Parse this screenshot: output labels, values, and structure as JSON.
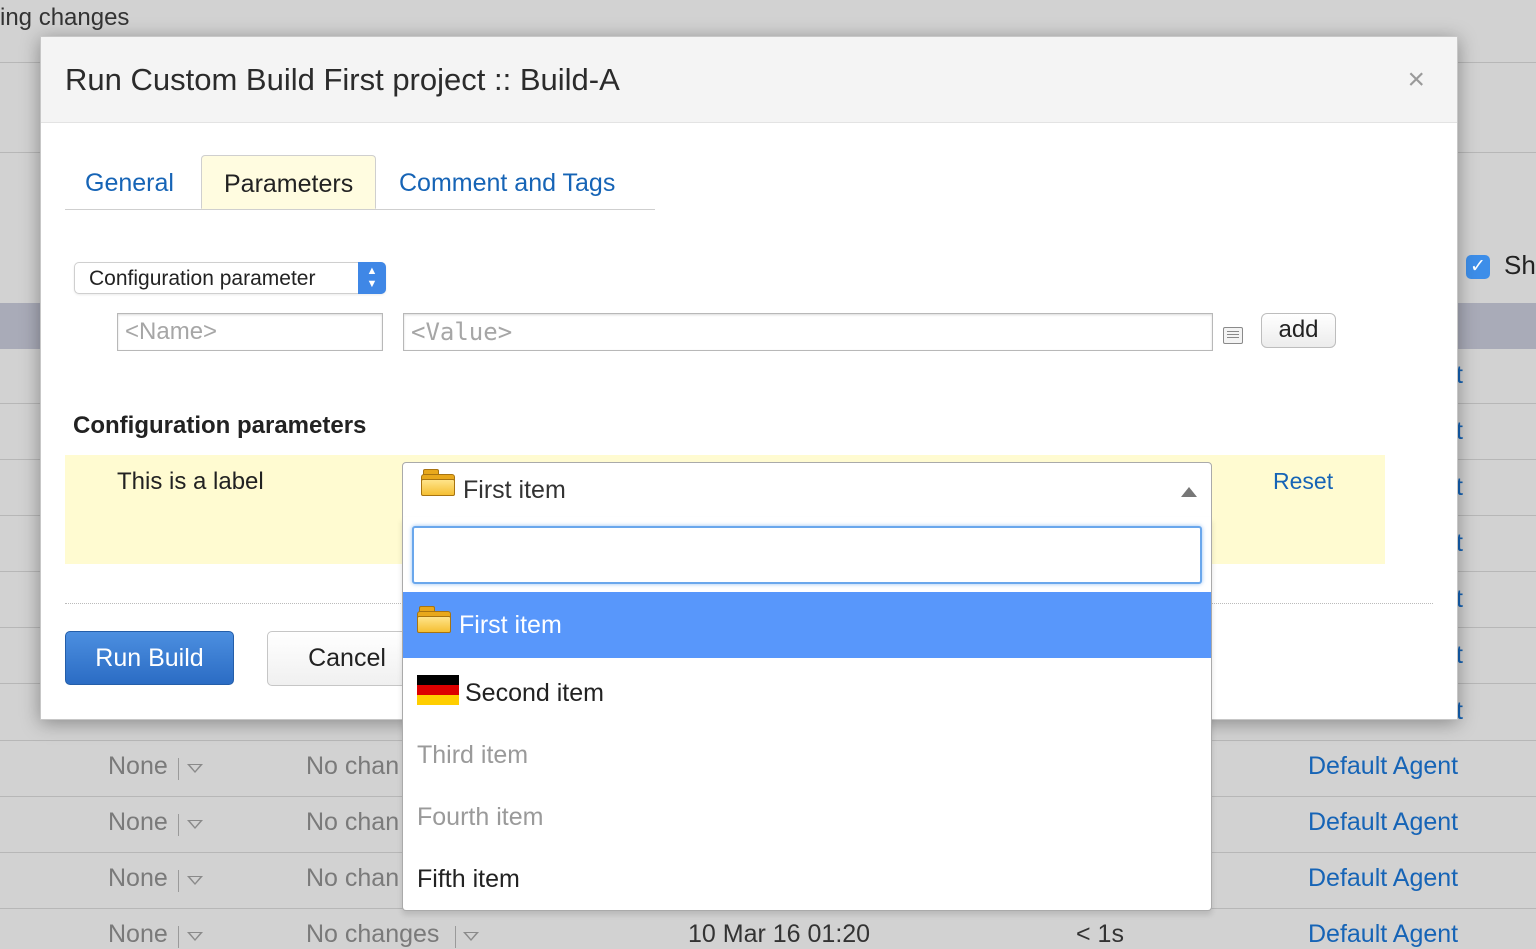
{
  "background": {
    "top_text": "ing changes",
    "checkbox_label": "Sh",
    "partial_link_char": "t",
    "rows": [
      {
        "revision": "None",
        "changes": "No chan",
        "agent": "Default Agent"
      },
      {
        "revision": "None",
        "changes": "No chan",
        "agent": "Default Agent"
      },
      {
        "revision": "None",
        "changes": "No chan",
        "agent": "Default Agent"
      },
      {
        "revision": "None",
        "changes": "No changes",
        "date": "10 Mar 16 01:20",
        "duration": "< 1s",
        "agent": "Default Agent"
      }
    ]
  },
  "dialog": {
    "title": "Run Custom Build First project :: Build-A",
    "close_symbol": "×",
    "tabs": [
      {
        "label": "General",
        "active": false
      },
      {
        "label": "Parameters",
        "active": true
      },
      {
        "label": "Comment and Tags",
        "active": false
      }
    ],
    "param_type_select": {
      "value": "Configuration parameter"
    },
    "name_input": {
      "placeholder": "<Name>",
      "value": ""
    },
    "value_input": {
      "placeholder": "<Value>",
      "value": ""
    },
    "add_label": "add",
    "section_title": "Configuration parameters",
    "param": {
      "label": "This is a label",
      "selected": "First item",
      "reset_label": "Reset"
    },
    "run_label": "Run Build",
    "cancel_label": "Cancel"
  },
  "dropdown": {
    "search_value": "",
    "items": [
      {
        "label": "First item",
        "icon": "folder-icon",
        "state": "selected"
      },
      {
        "label": "Second item",
        "icon": "german-flag-icon",
        "state": "normal"
      },
      {
        "label": "Third item",
        "icon": "",
        "state": "disabled"
      },
      {
        "label": "Fourth item",
        "icon": "",
        "state": "disabled"
      },
      {
        "label": "Fifth item",
        "icon": "",
        "state": "normal"
      }
    ]
  },
  "colors": {
    "accent": "#5897fb",
    "link": "#1664b6",
    "param_row_bg": "#fffbd1",
    "run_button": "#2b6cc4"
  }
}
